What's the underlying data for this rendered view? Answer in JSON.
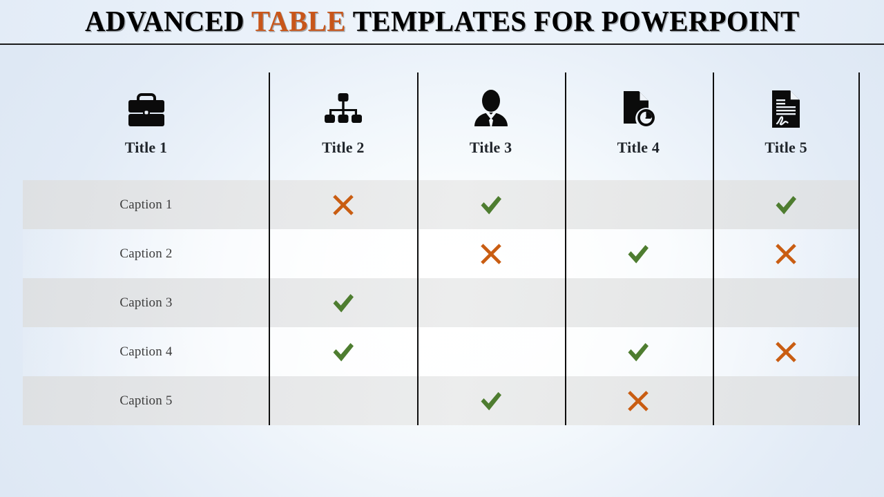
{
  "slide": {
    "title_part1": "ADVANCED ",
    "title_accent": "TABLE",
    "title_part2": " TEMPLATES FOR POWERPOINT",
    "accent_color": "#c8561a",
    "title_color": "#000000",
    "background_color": "#e4edf7"
  },
  "table": {
    "columns": [
      {
        "label": "Title 1",
        "icon": "briefcase-icon"
      },
      {
        "label": "Title 2",
        "icon": "org-chart-icon"
      },
      {
        "label": "Title 3",
        "icon": "businessman-icon"
      },
      {
        "label": "Title 4",
        "icon": "document-clock-icon"
      },
      {
        "label": "Title 5",
        "icon": "signed-document-icon"
      }
    ],
    "check_color": "#4e7d30",
    "cross_color": "#c95d12",
    "rows": [
      {
        "caption": "Caption 1",
        "values": [
          "cross",
          "check",
          "none",
          "check"
        ]
      },
      {
        "caption": "Caption 2",
        "values": [
          "none",
          "cross",
          "check",
          "cross"
        ]
      },
      {
        "caption": "Caption 3",
        "values": [
          "check",
          "none",
          "none",
          "none"
        ]
      },
      {
        "caption": "Caption 4",
        "values": [
          "check",
          "none",
          "check",
          "cross"
        ]
      },
      {
        "caption": "Caption 5",
        "values": [
          "none",
          "check",
          "cross",
          "none"
        ]
      }
    ]
  }
}
